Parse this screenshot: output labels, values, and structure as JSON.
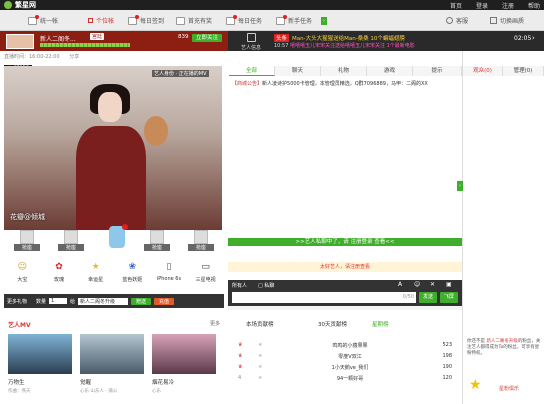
{
  "brand": {
    "logo_text": "繁星网"
  },
  "topbar": {
    "links": [
      "首页",
      "登录",
      "注册",
      "帮助"
    ]
  },
  "nav": {
    "items": [
      {
        "label": "统一帐",
        "badge": "6"
      },
      {
        "label": "个位帐"
      },
      {
        "label": "每日签到"
      },
      {
        "label": "首充有奖"
      },
      {
        "label": "每日任务"
      },
      {
        "label": "新手任务"
      }
    ],
    "right": [
      "客服",
      "切换画质"
    ]
  },
  "host": {
    "name": "新人二阁冬...",
    "level_tag": "宫廷",
    "follow_count": "839",
    "follow_btn": "立即关注",
    "badge": "47653",
    "time": "直播时间：16:00-22:00",
    "share": "分享",
    "live_tag": "艺人身份 · 正在播的MV",
    "watermark": "花瓣@倾城",
    "avatar_label": "艺人信息"
  },
  "announce": {
    "tag": "头条",
    "ticker": [
      {
        "time": "10:57",
        "text": "Man-大头大猩猩送给Man-桑桑 10个蝙蝠翅膀"
      },
      {
        "time": "10:57",
        "text": "嘻嘻嘻玉儿宋宋关注送给嘻嘻玉儿宋宋关注 1个最新电影"
      },
      {
        "time": "10:57",
        "text": "心底d由由送给你随随 1个月卡玩起来看"
      }
    ],
    "clock": "02:05"
  },
  "chat_tabs": [
    "全部",
    "聊天",
    "礼物",
    "游戏",
    "提示",
    "观众(0)",
    "管理(0)"
  ],
  "chat_msg": {
    "prefix": "【商城公告】",
    "text": "新人凌诗护5000卡管理，本管理员精选，Q群7096889，马甲：二阁的XX"
  },
  "chat_bar": {
    "text": ">>艺人私聊中了，请 注册登录 查看<<"
  },
  "chat_hint": "太好艺人，请注册查看",
  "chat_input": {
    "label": "所有人",
    "private": "私聊",
    "counter": "0/50",
    "send": "发送",
    "fly": "飞屏"
  },
  "seats": [
    {
      "label": "抢座"
    },
    {
      "label": "抢座"
    },
    {
      "label": "抢座"
    },
    {
      "label": "抢座"
    },
    {
      "label": "抢座"
    }
  ],
  "gifts": [
    {
      "name": "大宝",
      "icon": "smiley-icon"
    },
    {
      "name": "玫瑰",
      "icon": "rose-icon"
    },
    {
      "name": "幸运星",
      "icon": "star-icon"
    },
    {
      "name": "蓝色妖姬",
      "icon": "flower-icon"
    },
    {
      "name": "iPhone 6s",
      "icon": "phone-icon"
    },
    {
      "name": "三星电视",
      "icon": "tv-icon"
    }
  ],
  "gift_bar": {
    "more": "更多礼物",
    "qty_label": "数量",
    "qty": "1",
    "to_label": "给",
    "to": "新人二阁冬升级",
    "send": "赠送",
    "recharge": "充值"
  },
  "mv": {
    "title": "艺人MV",
    "more": "更多",
    "items": [
      "万物生",
      "觉醒",
      "烟花易冷"
    ],
    "subs": [
      "作曲：燕天",
      "心乐 山东人 · 蒲公",
      "心乐"
    ]
  },
  "rank": {
    "tabs": [
      "本场贡献榜",
      "30天贡献榜",
      "星期榜"
    ],
    "rows": [
      {
        "name": "鸣鸣的小蕴果果",
        "value": "523"
      },
      {
        "name": "零度V双江",
        "value": "198"
      },
      {
        "name": "1小天鹅ve_我们",
        "value": "190"
      },
      {
        "name": "94一颗好哥",
        "value": "120"
      }
    ]
  },
  "fan": {
    "text1": "你还不是",
    "link": "新人二阁冬升级",
    "text2": "的粉丝，关注艺人都得成为Ta的粉丝，可享有星粉特权。",
    "club": "星粉俱乐"
  },
  "colors": {
    "accent": "#3fae2a",
    "brand": "#8c1e12",
    "badge": "#e02020"
  }
}
